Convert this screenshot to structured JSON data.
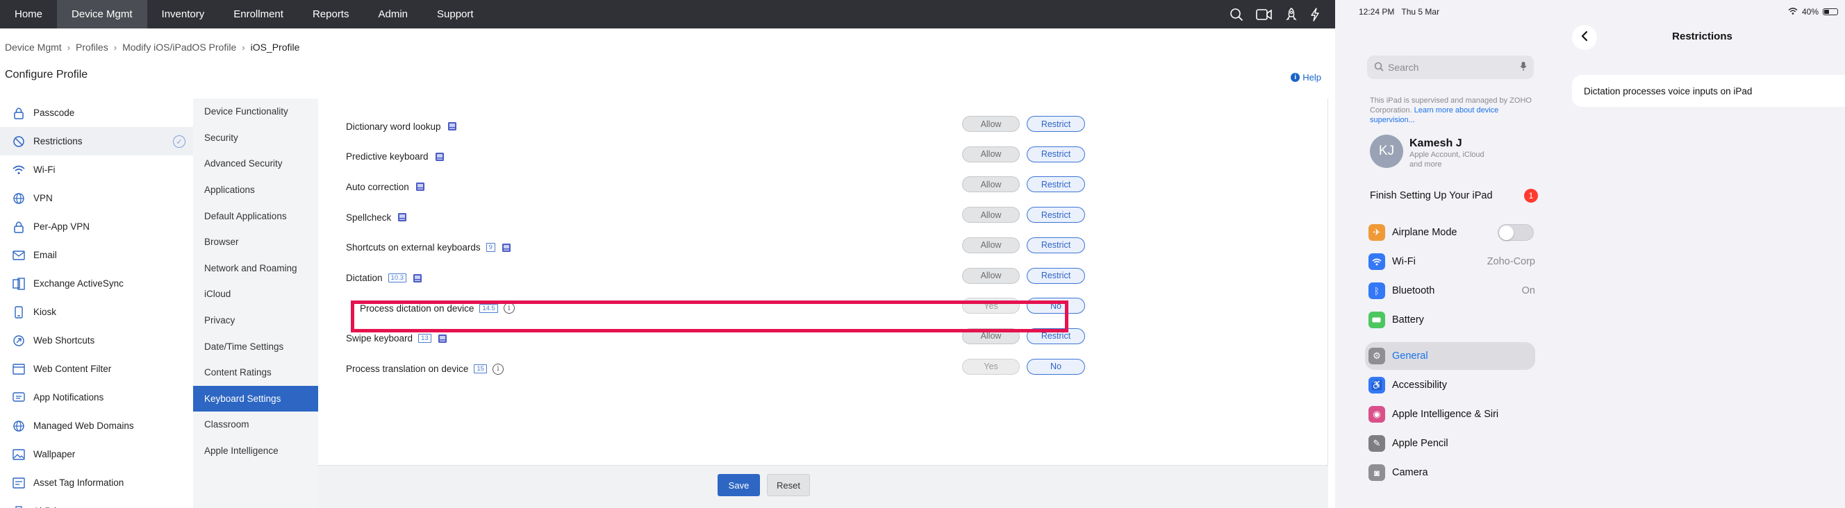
{
  "nav": {
    "items": [
      "Home",
      "Device Mgmt",
      "Inventory",
      "Enrollment",
      "Reports",
      "Admin",
      "Support"
    ],
    "active": "Device Mgmt",
    "icons": [
      "search-icon",
      "video-icon",
      "rocket-icon",
      "lightning-icon"
    ]
  },
  "breadcrumb": [
    "Device Mgmt",
    "Profiles",
    "Modify iOS/iPadOS Profile",
    "iOS_Profile"
  ],
  "page_title": "Configure Profile",
  "help_label": "Help",
  "profile_list": [
    {
      "label": "Passcode",
      "icon": "lock-icon"
    },
    {
      "label": "Restrictions",
      "icon": "restriction-icon",
      "active": true
    },
    {
      "label": "Wi-Fi",
      "icon": "wifi-icon"
    },
    {
      "label": "VPN",
      "icon": "globe-icon"
    },
    {
      "label": "Per-App VPN",
      "icon": "lock-icon"
    },
    {
      "label": "Email",
      "icon": "mail-icon"
    },
    {
      "label": "Exchange ActiveSync",
      "icon": "exchange-icon"
    },
    {
      "label": "Kiosk",
      "icon": "kiosk-icon"
    },
    {
      "label": "Web Shortcuts",
      "icon": "web-shortcut-icon"
    },
    {
      "label": "Web Content Filter",
      "icon": "filter-icon"
    },
    {
      "label": "App Notifications",
      "icon": "notification-icon"
    },
    {
      "label": "Managed Web Domains",
      "icon": "globe-icon"
    },
    {
      "label": "Wallpaper",
      "icon": "image-icon"
    },
    {
      "label": "Asset Tag Information",
      "icon": "tag-icon"
    },
    {
      "label": "AirPrint",
      "icon": "printer-icon"
    }
  ],
  "sub_list": [
    "Device Functionality",
    "Security",
    "Advanced Security",
    "Applications",
    "Default Applications",
    "Browser",
    "Network and Roaming",
    "iCloud",
    "Privacy",
    "Date/Time Settings",
    "Content Ratings",
    "Keyboard Settings",
    "Classroom",
    "Apple Intelligence"
  ],
  "sub_active": "Keyboard Settings",
  "settings": [
    {
      "label": "Dictionary word lookup",
      "version": "",
      "supervised": true,
      "info": false,
      "opt1": "Allow",
      "opt2": "Restrict",
      "selected": "Restrict"
    },
    {
      "label": "Predictive keyboard",
      "version": "",
      "supervised": true,
      "info": false,
      "opt1": "Allow",
      "opt2": "Restrict",
      "selected": "Restrict"
    },
    {
      "label": "Auto correction",
      "version": "",
      "supervised": true,
      "info": false,
      "opt1": "Allow",
      "opt2": "Restrict",
      "selected": "Restrict"
    },
    {
      "label": "Spellcheck",
      "version": "",
      "supervised": true,
      "info": false,
      "opt1": "Allow",
      "opt2": "Restrict",
      "selected": "Restrict"
    },
    {
      "label": "Shortcuts on external keyboards",
      "version": "9",
      "supervised": true,
      "info": false,
      "opt1": "Allow",
      "opt2": "Restrict",
      "selected": "Restrict"
    },
    {
      "label": "Dictation",
      "version": "10.3",
      "supervised": true,
      "info": false,
      "opt1": "Allow",
      "opt2": "Restrict",
      "selected": "Restrict"
    },
    {
      "label": "Process dictation on device",
      "version": "14.5",
      "supervised": false,
      "info": true,
      "opt1": "Yes",
      "opt2": "No",
      "selected": "No",
      "highlighted": true
    },
    {
      "label": "Swipe keyboard",
      "version": "13",
      "supervised": true,
      "info": false,
      "opt1": "Allow",
      "opt2": "Restrict",
      "selected": "Restrict"
    },
    {
      "label": "Process translation on device",
      "version": "15",
      "supervised": false,
      "info": true,
      "opt1": "Yes",
      "opt2": "No",
      "selected": "No"
    }
  ],
  "footer": {
    "save": "Save",
    "reset": "Reset"
  },
  "colors": {
    "accent": "#2d66c3",
    "highlight": "#e5124f",
    "nav_bg": "#2f3136"
  },
  "ipad": {
    "status": {
      "time": "12:24 PM",
      "date": "Thu 5 Mar",
      "battery": "40%"
    },
    "search_placeholder": "Search",
    "supervision_note": "This iPad is supervised and managed by ZOHO Corporation.",
    "supervision_link": "Learn more about device supervision...",
    "account": {
      "initials": "KJ",
      "name": "Kamesh J",
      "sub": "Apple Account, iCloud and more"
    },
    "finish_setup": {
      "label": "Finish Setting Up Your iPad",
      "badge": "1"
    },
    "settings_rows": [
      {
        "label": "Airplane Mode",
        "icon": "airplane-icon",
        "color": "#f09a37",
        "toggle": true,
        "value": ""
      },
      {
        "label": "Wi-Fi",
        "icon": "wifi-icon",
        "color": "#3478f6",
        "value": "Zoho-Corp"
      },
      {
        "label": "Bluetooth",
        "icon": "bluetooth-icon",
        "color": "#3478f6",
        "value": "On"
      },
      {
        "label": "Battery",
        "icon": "battery-icon",
        "color": "#4cc760",
        "value": ""
      },
      {
        "label": "General",
        "icon": "gear-icon",
        "color": "#8e8e93",
        "value": "",
        "selected": true
      },
      {
        "label": "Accessibility",
        "icon": "accessibility-icon",
        "color": "#3478f6",
        "value": ""
      },
      {
        "label": "Apple Intelligence & Siri",
        "icon": "siri-icon",
        "color": "#d9508a",
        "value": ""
      },
      {
        "label": "Apple Pencil",
        "icon": "pencil-icon",
        "color": "#7d7d82",
        "value": ""
      },
      {
        "label": "Camera",
        "icon": "camera-icon",
        "color": "#8e8e93",
        "value": ""
      }
    ],
    "detail_title": "Restrictions",
    "detail_item": "Dictation processes voice inputs on iPad"
  }
}
